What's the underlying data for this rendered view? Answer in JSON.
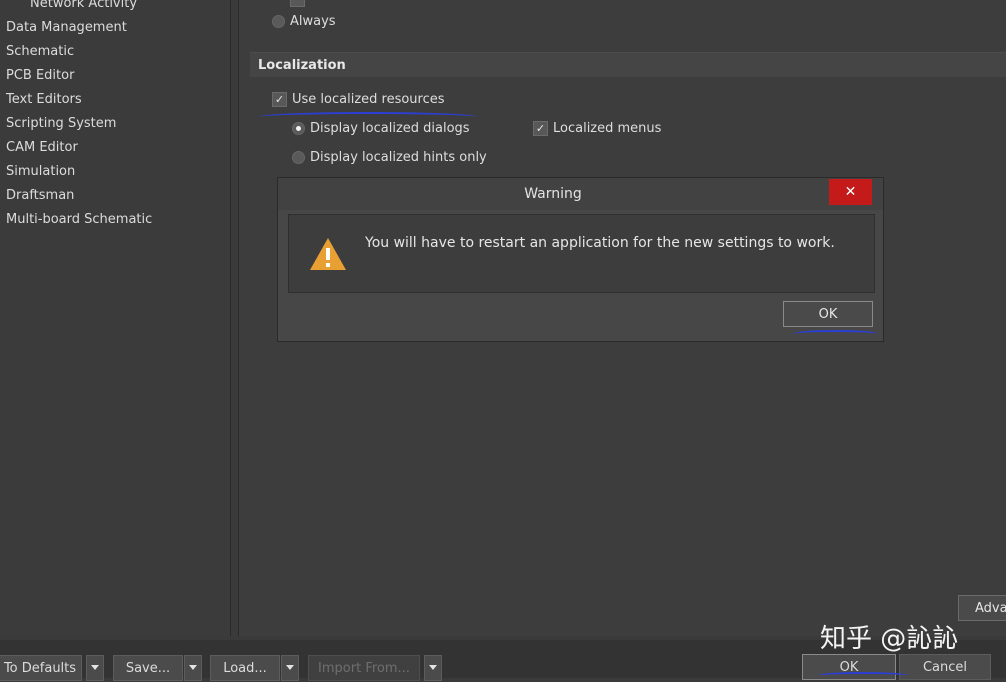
{
  "sidebar": {
    "items": [
      {
        "label": "Network Activity",
        "sub": true
      },
      {
        "label": "Data Management"
      },
      {
        "label": "Schematic"
      },
      {
        "label": "PCB Editor"
      },
      {
        "label": "Text Editors"
      },
      {
        "label": "Scripting System"
      },
      {
        "label": "CAM Editor"
      },
      {
        "label": "Simulation"
      },
      {
        "label": "Draftsman"
      },
      {
        "label": "Multi-board Schematic"
      }
    ]
  },
  "content": {
    "always_label": "Always",
    "section_title": "Localization",
    "use_localized_label": "Use localized resources",
    "dialogs_label": "Display localized dialogs",
    "hints_label": "Display localized hints only",
    "menus_label": "Localized menus",
    "advanced_label": "Adva"
  },
  "dialog": {
    "title": "Warning",
    "close_glyph": "✕",
    "message": "You will have to restart an application for the new settings to work.",
    "ok_label": "OK"
  },
  "bottom": {
    "defaults_label": "To Defaults",
    "save_label": "Save...",
    "load_label": "Load...",
    "import_label": "Import From...",
    "ok_label": "OK",
    "cancel_label": "Cancel"
  },
  "watermark": "知乎 @訫訫",
  "colors": {
    "accent_ink": "#2b3fd6",
    "close": "#c41a1a",
    "warning": "#e8a033"
  }
}
